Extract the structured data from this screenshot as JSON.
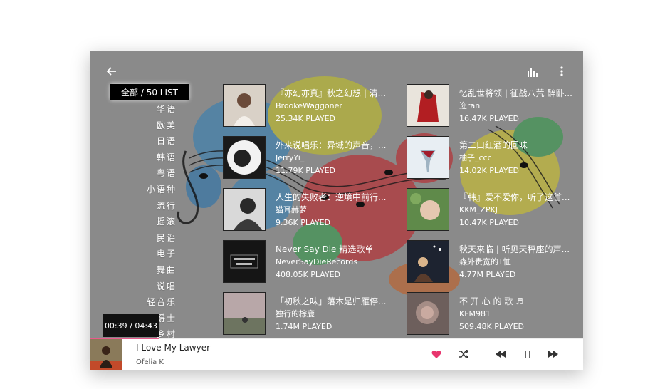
{
  "categories": {
    "all_label": "全部 / 50 LIST",
    "items": [
      "华语",
      "欧美",
      "日语",
      "韩语",
      "粤语",
      "小语种",
      "流行",
      "摇滚",
      "民谣",
      "电子",
      "舞曲",
      "说唱",
      "轻音乐",
      "爵士",
      "乡村"
    ]
  },
  "playlists": [
    {
      "title": "『亦幻亦真』秋之幻想 | 清...",
      "author": "BrookeWaggoner",
      "plays": "25.34K PLAYED"
    },
    {
      "title": "忆乱世将领 | 征战八荒 醉卧...",
      "author": "迩ran",
      "plays": "16.47K PLAYED"
    },
    {
      "title": "外来说唱乐：异域的声音，...",
      "author": "JerryYi_",
      "plays": "11.79K PLAYED"
    },
    {
      "title": "第二口红酒的回味",
      "author": "柚子_ccc",
      "plays": "14.02K PLAYED"
    },
    {
      "title": "人生的失败者：逆境中前行...",
      "author": "猫耳赫萝",
      "plays": "9.36K PLAYED"
    },
    {
      "title": "『韩』爱不爱你，听了这首...",
      "author": "KKM_ZPKJ",
      "plays": "10.47K PLAYED"
    },
    {
      "title": "Never Say Die 精选歌单",
      "author": "NeverSayDieRecords",
      "plays": "408.05K PLAYED"
    },
    {
      "title": "秋天来临 | 听见天秤座的声...",
      "author": "森外贵宽的T恤",
      "plays": "4.77M PLAYED"
    },
    {
      "title": "「初秋之味」落木是归雁停...",
      "author": "独行的棕鹿",
      "plays": "1.74M PLAYED"
    },
    {
      "title": "不 开 心 的 歌 ♬",
      "author": "KFM981",
      "plays": "509.48K PLAYED"
    }
  ],
  "player": {
    "time": "00:39 / 04:43",
    "progress": 0.14,
    "song": "I Love My Lawyer",
    "artist": "Ofelia K"
  },
  "colors": {
    "accent": "#e85a8d",
    "overlay": "#8b8b8b"
  },
  "icons": {
    "back": "arrow-left-icon",
    "equalizer": "equalizer-icon",
    "more": "more-vertical-icon",
    "heart": "heart-icon",
    "shuffle": "shuffle-icon",
    "prev": "skip-back-icon",
    "pause": "pause-icon",
    "next": "skip-forward-icon"
  }
}
